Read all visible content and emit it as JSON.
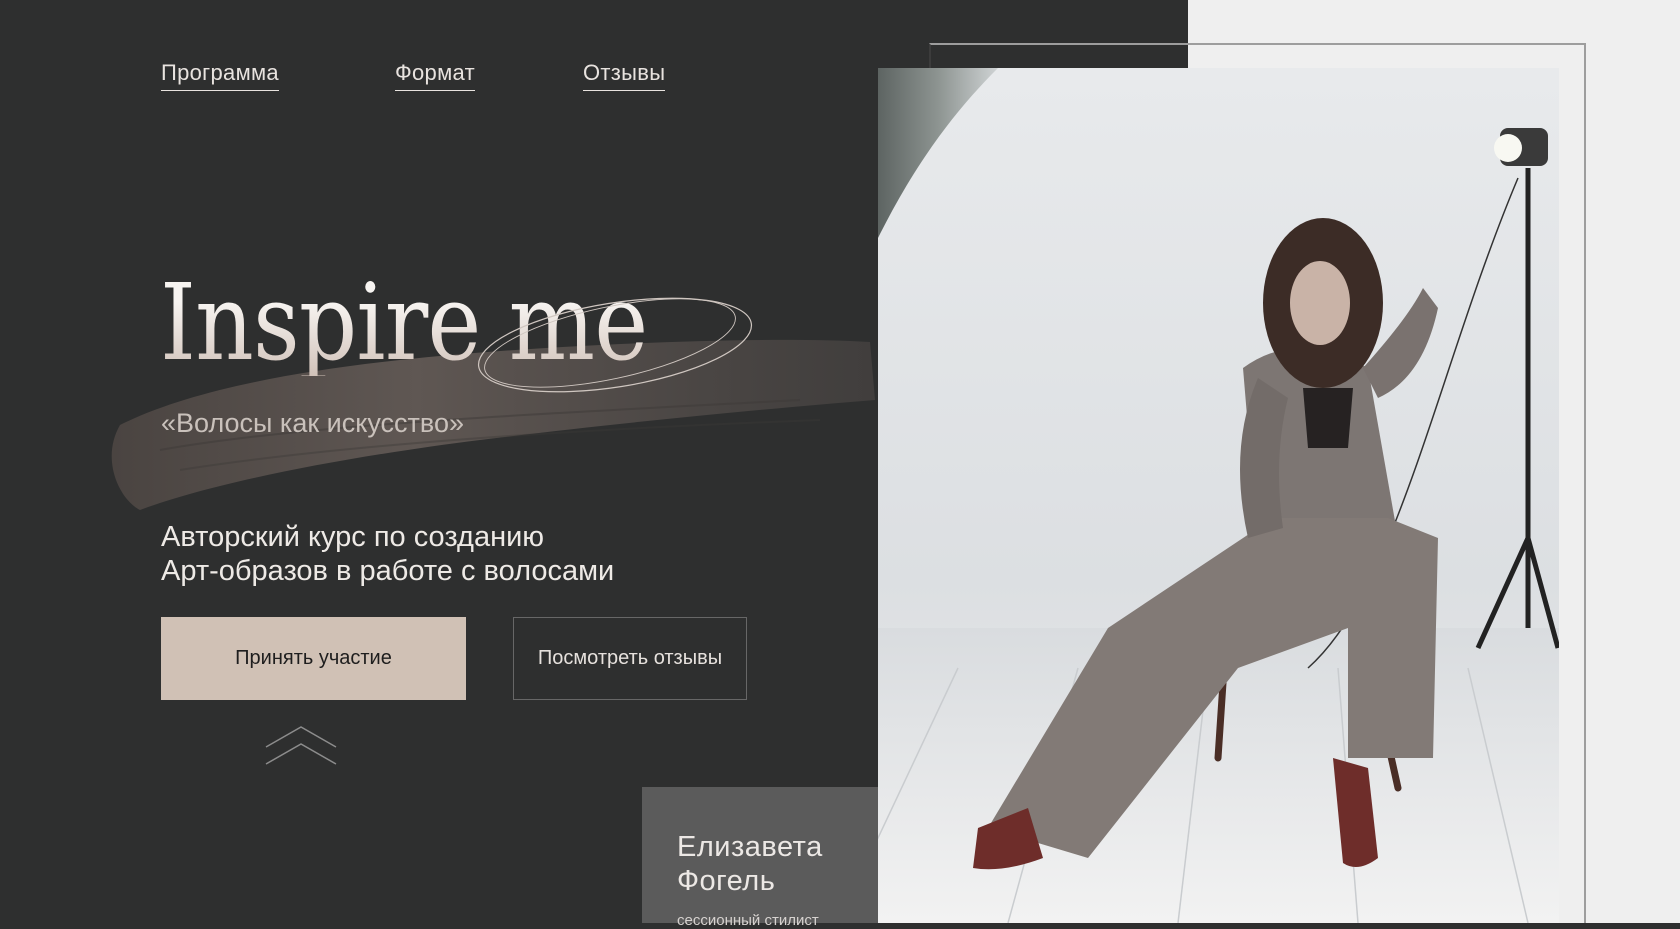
{
  "nav": {
    "items": [
      {
        "label": "Программа"
      },
      {
        "label": "Формат"
      },
      {
        "label": "Отзывы"
      }
    ]
  },
  "hero": {
    "title": "Inspire me",
    "subtitle": "«Волосы как искусство»",
    "description_line1": "Авторский курс по созданию",
    "description_line2": "Арт-образов в работе с волосами"
  },
  "buttons": {
    "primary_label": "Принять участие",
    "secondary_label": "Посмотреть отзывы"
  },
  "author": {
    "name_line1": "Елизавета",
    "name_line2": "Фогель",
    "role": "сессионный стилист"
  },
  "colors": {
    "background_dark": "#2e2f2f",
    "accent_beige": "#d0c1b5",
    "card_gray": "#5b5b5b",
    "light_panel": "#efefef"
  },
  "icons": {
    "scroll_up": "double-chevron-up-icon"
  }
}
